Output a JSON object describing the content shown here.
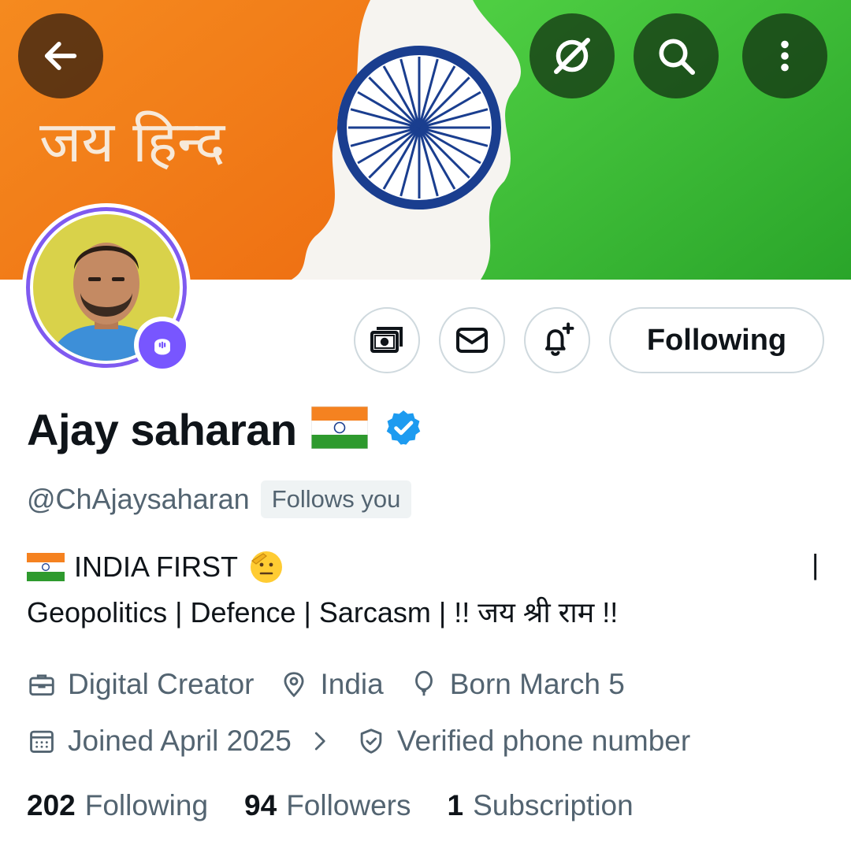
{
  "header": {
    "back_icon": "arrow-left-icon",
    "grok_icon": "slashed-circle-icon",
    "search_icon": "search-icon",
    "more_icon": "more-vertical-icon",
    "banner_text": "जय हिन्द"
  },
  "actions": {
    "tip_icon": "money-icon",
    "message_icon": "mail-icon",
    "notify_icon": "bell-plus-icon",
    "following_label": "Following"
  },
  "profile": {
    "name": "Ajay saharan",
    "handle": "@ChAjaysaharan",
    "follows_you": "Follows you",
    "bio_line1": "INDIA FIRST",
    "bio_pipe": "|",
    "bio_line2": "Geopolitics | Defence | Sarcasm |  !! जय श्री राम !!",
    "category": "Digital Creator",
    "location": "India",
    "birthday": "Born March 5",
    "joined": "Joined April 2025",
    "verified_phone": "Verified phone number"
  },
  "stats": {
    "following_count": "202",
    "following_label": "Following",
    "followers_count": "94",
    "followers_label": "Followers",
    "subscription_count": "1",
    "subscription_label": "Subscription"
  },
  "colors": {
    "accent": "#1d9bf0",
    "spaces": "#7856ff",
    "saffron": "#f47b20",
    "green": "#2eb82e",
    "navy": "#1a3e8f"
  }
}
